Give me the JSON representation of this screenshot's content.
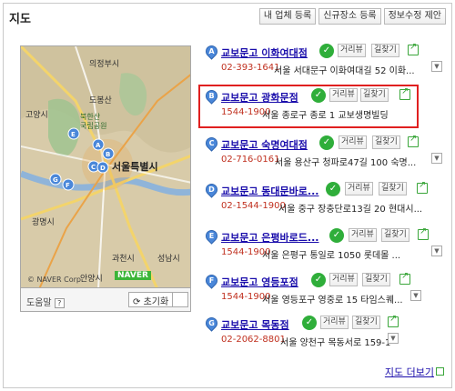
{
  "header": {
    "title": "지도"
  },
  "toolbar": {
    "btn1": "내 업체 등록",
    "btn2": "신규장소 등록",
    "btn3": "정보수정 제안"
  },
  "map": {
    "labels": {
      "uijeongbu": "의정부시",
      "dobong": "도봉산",
      "goyang": "고양시",
      "bukhansan": "북한산\n국립공원",
      "seoul": "서울특별시",
      "gwangmyeong": "광명시",
      "gwacheon": "과천시",
      "anyang": "안양시",
      "seongnam": "성남시"
    },
    "badge": "NAVER",
    "copyright": "© NAVER Corp.",
    "help": "도움말",
    "help_q": "?",
    "reset": "초기화",
    "markers": [
      "A",
      "B",
      "C",
      "D",
      "E",
      "F",
      "G"
    ]
  },
  "items": [
    {
      "letter": "A",
      "name": "교보문고 이화여대점",
      "phone": "02-393-1641",
      "addr": "서울 서대문구 이화여대길 52 이화..."
    },
    {
      "letter": "B",
      "name": "교보문고 광화문점",
      "phone": "1544-1900",
      "addr": "서울 종로구 종로 1 교보생명빌딩"
    },
    {
      "letter": "C",
      "name": "교보문고 숙명여대점",
      "phone": "02-716-0161",
      "addr": "서울 용산구 청파로47길 100 숙명..."
    },
    {
      "letter": "D",
      "name": "교보문고 동대문바로...",
      "phone": "02-1544-1900",
      "addr": "서울 중구 장충단로13길 20 현대시..."
    },
    {
      "letter": "E",
      "name": "교보문고 은평바로드...",
      "phone": "1544-1900",
      "addr": "서울 은평구 통일로 1050 롯데몰 ..."
    },
    {
      "letter": "F",
      "name": "교보문고 영등포점",
      "phone": "1544-1900",
      "addr": "서울 영등포구 영중로 15 타임스퀘..."
    },
    {
      "letter": "G",
      "name": "교보문고 목동점",
      "phone": "02-2062-8801",
      "addr": "서울 양천구 목동서로 159-1"
    }
  ],
  "item_buttons": {
    "review": "거리뷰",
    "route": "길찾기"
  },
  "footer": {
    "more": "지도 더보기"
  },
  "colors": {
    "accent": "#1a0dab",
    "phone": "#c0301f",
    "highlight": "#e02020",
    "check": "#2fae3a"
  }
}
